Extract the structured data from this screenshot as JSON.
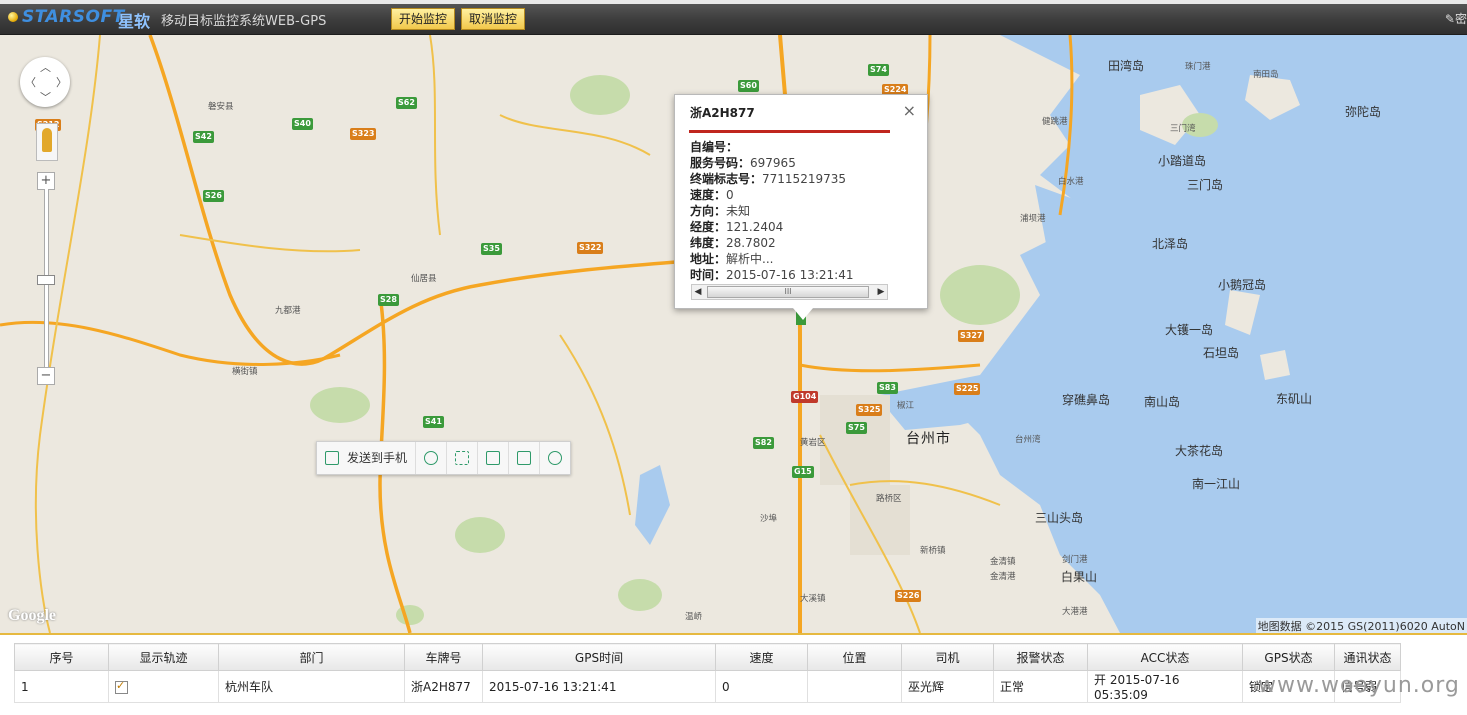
{
  "header": {
    "logo_text": "STARSOFT",
    "logo_cn": "星软",
    "title": "移动目标监控系统WEB-GPS",
    "start_btn": "开始监控",
    "cancel_btn": "取消监控",
    "right_link": "密"
  },
  "map": {
    "google_logo": "Google",
    "copyright": "地图数据 ©2015 GS(2011)6020 AutoN",
    "toolbar": {
      "send_label": "发送到手机",
      "icons": [
        "send-icon",
        "cloud-icon",
        "fullscreen-icon",
        "save-icon",
        "share-icon",
        "settings-icon"
      ]
    },
    "places": [
      {
        "t": "田湾岛"
      },
      {
        "t": "珠门港"
      },
      {
        "t": "南田岛"
      },
      {
        "t": "弥陀岛"
      },
      {
        "t": "三门湾"
      },
      {
        "t": "小踏道岛"
      },
      {
        "t": "三门岛"
      },
      {
        "t": "北泽岛"
      },
      {
        "t": "小鹅冠岛"
      },
      {
        "t": "大镬一岛"
      },
      {
        "t": "石坦岛"
      },
      {
        "t": "穿礁鼻岛"
      },
      {
        "t": "南山岛"
      },
      {
        "t": "东矶山"
      },
      {
        "t": "大茶花岛"
      },
      {
        "t": "南一江山"
      },
      {
        "t": "三山头岛"
      },
      {
        "t": "白果山"
      },
      {
        "t": "台州市"
      },
      {
        "t": "仙居县"
      },
      {
        "t": "九都港"
      },
      {
        "t": "磐安县"
      },
      {
        "t": "黄岩区"
      },
      {
        "t": "路桥区"
      },
      {
        "t": "椒江"
      },
      {
        "t": "台州湾"
      },
      {
        "t": "剑门港"
      },
      {
        "t": "金清港"
      },
      {
        "t": "大港港"
      },
      {
        "t": "浦坝港"
      },
      {
        "t": "健跳港"
      },
      {
        "t": "白水港"
      },
      {
        "t": "沙埠"
      },
      {
        "t": "金清镇"
      },
      {
        "t": "新桥镇"
      },
      {
        "t": "大溪镇"
      },
      {
        "t": "温峤"
      },
      {
        "t": "横街镇"
      }
    ],
    "roads": [
      {
        "t": "S212"
      },
      {
        "t": "S42"
      },
      {
        "t": "S26"
      },
      {
        "t": "S40"
      },
      {
        "t": "S62"
      },
      {
        "t": "S323"
      },
      {
        "t": "S60"
      },
      {
        "t": "S74"
      },
      {
        "t": "S224"
      },
      {
        "t": "S35"
      },
      {
        "t": "S322"
      },
      {
        "t": "S28"
      },
      {
        "t": "S41"
      },
      {
        "t": "S327"
      },
      {
        "t": "S83"
      },
      {
        "t": "S325"
      },
      {
        "t": "S75"
      },
      {
        "t": "S82"
      },
      {
        "t": "G15"
      },
      {
        "t": "G104"
      },
      {
        "t": "S225"
      },
      {
        "t": "S226"
      }
    ]
  },
  "popup": {
    "title": "浙A2H877",
    "close": "×",
    "rows": [
      {
        "k": "自编号：",
        "v": ""
      },
      {
        "k": "服务号码：",
        "v": "697965"
      },
      {
        "k": "终端标志号：",
        "v": "77115219735"
      },
      {
        "k": "速度：",
        "v": "0"
      },
      {
        "k": "方向：",
        "v": "未知"
      },
      {
        "k": "经度：",
        "v": "121.2404"
      },
      {
        "k": "纬度：",
        "v": "28.7802"
      },
      {
        "k": "地址：",
        "v": "解析中..."
      },
      {
        "k": "时间：",
        "v": "2015-07-16 13:21:41"
      }
    ],
    "scroll_thumb": "III"
  },
  "grid": {
    "headers": [
      "序号",
      "显示轨迹",
      "部门",
      "车牌号",
      "GPS时间",
      "速度",
      "位置",
      "司机",
      "报警状态",
      "ACC状态",
      "GPS状态",
      "通讯状态"
    ],
    "rows": [
      {
        "idx": "1",
        "dept": "杭州车队",
        "plate": "浙A2H877",
        "gps_time": "2015-07-16 13:21:41",
        "speed": "0",
        "location": "",
        "driver": "巫光辉",
        "alarm": "正常",
        "acc": "开 2015-07-16 05:35:09",
        "gps_status": "锁定",
        "comm": "信号弱"
      }
    ]
  },
  "watermark": "www.wooyun.org"
}
